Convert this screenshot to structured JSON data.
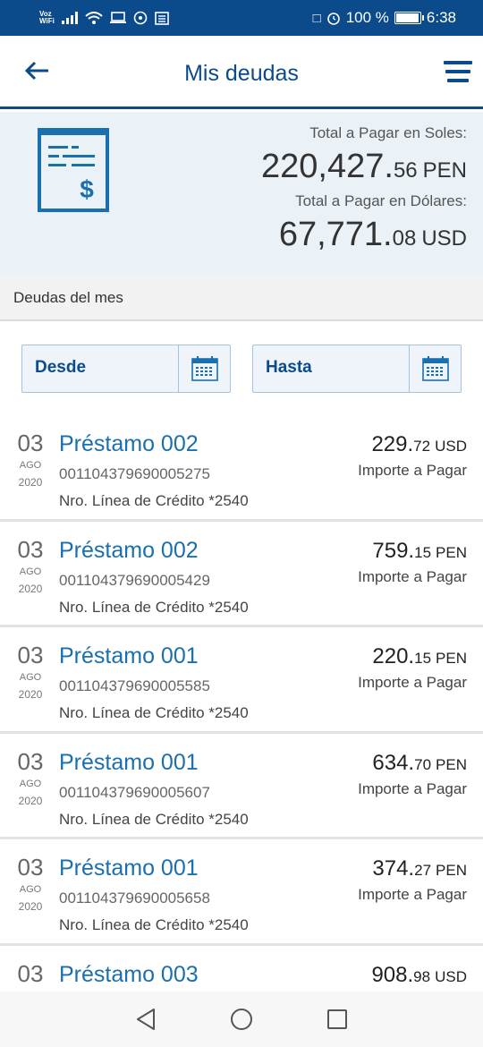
{
  "status_bar": {
    "carrier_top": "Voz",
    "carrier_bottom": "WiFi",
    "battery": "100 %",
    "battery_level": 1.0,
    "time": "6:38"
  },
  "header": {
    "title": "Mis deudas"
  },
  "summary": {
    "soles_label": "Total a Pagar en Soles:",
    "soles_int": "220,427.",
    "soles_dec": "56",
    "soles_cur": "PEN",
    "dolares_label": "Total a Pagar en Dólares:",
    "dolares_int": "67,771.",
    "dolares_dec": "08",
    "dolares_cur": "USD"
  },
  "section": {
    "title": "Deudas del mes"
  },
  "filters": {
    "from_label": "Desde",
    "to_label": "Hasta"
  },
  "debts": [
    {
      "day": "03",
      "month": "AGO",
      "year": "2020",
      "title": "Préstamo 002",
      "account": "001104379690005275",
      "line": "Nro. Línea de Crédito *2540",
      "amount_int": "229.",
      "amount_dec": "72",
      "currency": "USD",
      "sublabel": "Importe a Pagar"
    },
    {
      "day": "03",
      "month": "AGO",
      "year": "2020",
      "title": "Préstamo 002",
      "account": "001104379690005429",
      "line": "Nro. Línea de Crédito *2540",
      "amount_int": "759.",
      "amount_dec": "15",
      "currency": "PEN",
      "sublabel": "Importe a Pagar"
    },
    {
      "day": "03",
      "month": "AGO",
      "year": "2020",
      "title": "Préstamo 001",
      "account": "001104379690005585",
      "line": "Nro. Línea de Crédito *2540",
      "amount_int": "220.",
      "amount_dec": "15",
      "currency": "PEN",
      "sublabel": "Importe a Pagar"
    },
    {
      "day": "03",
      "month": "AGO",
      "year": "2020",
      "title": "Préstamo 001",
      "account": "001104379690005607",
      "line": "Nro. Línea de Crédito *2540",
      "amount_int": "634.",
      "amount_dec": "70",
      "currency": "PEN",
      "sublabel": "Importe a Pagar"
    },
    {
      "day": "03",
      "month": "AGO",
      "year": "2020",
      "title": "Préstamo 001",
      "account": "001104379690005658",
      "line": "Nro. Línea de Crédito *2540",
      "amount_int": "374.",
      "amount_dec": "27",
      "currency": "PEN",
      "sublabel": "Importe a Pagar"
    },
    {
      "day": "03",
      "month": "",
      "year": "",
      "title": "Préstamo 003",
      "account": "",
      "line": "",
      "amount_int": "908.",
      "amount_dec": "98",
      "currency": "USD",
      "sublabel": ""
    }
  ],
  "icons": {
    "back": "arrow-left-icon",
    "menu": "hamburger-menu-icon",
    "document": "bill-document-icon",
    "calendar": "calendar-icon",
    "nav_back": "triangle-back-icon",
    "nav_home": "circle-home-icon",
    "nav_recent": "square-recent-icon"
  },
  "colors": {
    "primary": "#0b4a8b",
    "link": "#1a6fae",
    "summary_bg": "#eaf2f8"
  }
}
